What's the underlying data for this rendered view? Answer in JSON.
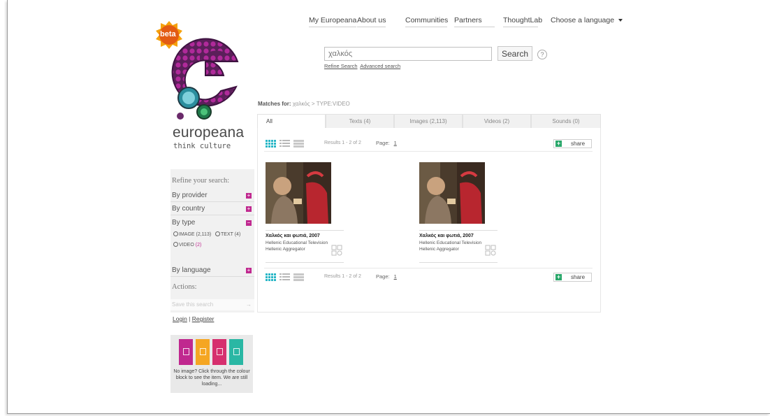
{
  "colors": {
    "accent": "#c0288f",
    "share_green": "#29a76a",
    "grid_teal": "#2ab7c7"
  },
  "brand": {
    "beta": "beta",
    "name": "europeana",
    "tagline": "think culture"
  },
  "topnav": [
    {
      "label": "My Europeana"
    },
    {
      "label": "About us"
    },
    {
      "label": "Communities"
    },
    {
      "label": "Partners"
    },
    {
      "label": "ThoughtLab"
    },
    {
      "label": "Choose a language"
    }
  ],
  "search": {
    "value": "χαλκός",
    "button": "Search",
    "help": "?",
    "refine_link": "Refine Search",
    "advanced_link": "Advanced search"
  },
  "matches": {
    "label": "Matches for:",
    "query": "χαλκός",
    "filter": "> TYPE:VIDEO"
  },
  "tabs": [
    {
      "label": "All"
    },
    {
      "label": "Texts (4)"
    },
    {
      "label": "Images (2,113)"
    },
    {
      "label": "Videos (2)"
    },
    {
      "label": "Sounds (0)"
    }
  ],
  "results_bar": {
    "count": "Results 1 - 2 of 2",
    "page_label": "Page:",
    "page_num": "1",
    "share": "share"
  },
  "results": [
    {
      "title": "Χαλκός και φωτιά, 2007",
      "provider": "Hellenic Educational Television",
      "aggregator": "Hellenic Aggregator"
    },
    {
      "title": "Χαλκός και φωτιά, 2007",
      "provider": "Hellenic Educational Television",
      "aggregator": "Hellenic Aggregator"
    }
  ],
  "sidebar": {
    "refine_heading": "Refine your search:",
    "by_provider": "By provider",
    "by_country": "By country",
    "by_type": "By type",
    "type_image": "IMAGE (2,113)",
    "type_text": "TEXT (4)",
    "type_video": "VIDEO",
    "type_video_count": "(2)",
    "by_language": "By language",
    "actions_heading": "Actions:",
    "save_search": "Save this search",
    "plus": "+",
    "minus": "−",
    "arrow": "→"
  },
  "login": {
    "login": "Login",
    "sep": " | ",
    "register": "Register"
  },
  "colour_block": {
    "text": "No image? Click through the colour block to see the item. We are still loading..."
  }
}
